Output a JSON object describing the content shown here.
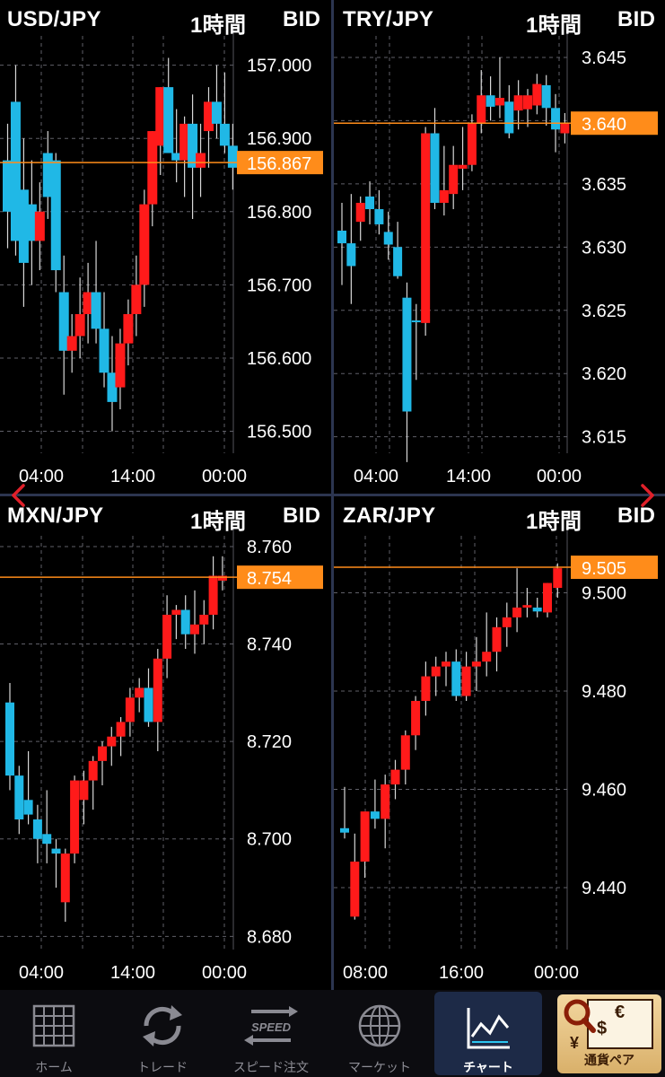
{
  "colors": {
    "up": "#ff1a1a",
    "down": "#20b8e6",
    "wick": "#d8d8d8",
    "price": "#ff8c1a",
    "grid": "#606068",
    "divider": "#2c3550"
  },
  "nav": {
    "prev_icon": "chevron-left-icon",
    "next_icon": "chevron-right-icon"
  },
  "charts": [
    {
      "pair": "USD/JPY",
      "timeframe": "1時間",
      "price_type": "BID",
      "current_price": "156.867",
      "current_value": 156.867,
      "y_ticks": [
        "157.000",
        "156.900",
        "156.800",
        "156.700",
        "156.600",
        "156.500"
      ],
      "ylim": [
        156.47,
        157.04
      ],
      "x_ticks": [
        "04:00",
        "14:00",
        "00:00"
      ],
      "candles": [
        [
          156.87,
          156.92,
          156.75,
          156.8
        ],
        [
          156.95,
          157.0,
          156.74,
          156.76
        ],
        [
          156.83,
          156.9,
          156.67,
          156.73
        ],
        [
          156.81,
          156.87,
          156.7,
          156.76
        ],
        [
          156.76,
          156.84,
          156.72,
          156.8
        ],
        [
          156.88,
          156.91,
          156.79,
          156.82
        ],
        [
          156.87,
          156.88,
          156.69,
          156.72
        ],
        [
          156.69,
          156.74,
          156.55,
          156.61
        ],
        [
          156.61,
          156.66,
          156.58,
          156.63
        ],
        [
          156.63,
          156.71,
          156.6,
          156.66
        ],
        [
          156.66,
          156.73,
          156.62,
          156.69
        ],
        [
          156.69,
          156.76,
          156.62,
          156.64
        ],
        [
          156.64,
          156.69,
          156.56,
          156.58
        ],
        [
          156.58,
          156.63,
          156.5,
          156.54
        ],
        [
          156.56,
          156.64,
          156.53,
          156.62
        ],
        [
          156.62,
          156.68,
          156.59,
          156.66
        ],
        [
          156.66,
          156.74,
          156.63,
          156.7
        ],
        [
          156.7,
          156.83,
          156.67,
          156.81
        ],
        [
          156.81,
          156.91,
          156.78,
          156.91
        ],
        [
          156.89,
          156.97,
          156.85,
          156.97
        ],
        [
          156.97,
          157.01,
          156.9,
          156.88
        ],
        [
          156.88,
          156.94,
          156.84,
          156.87
        ],
        [
          156.87,
          156.93,
          156.82,
          156.92
        ],
        [
          156.92,
          156.96,
          156.79,
          156.86
        ],
        [
          156.86,
          156.92,
          156.82,
          156.88
        ],
        [
          156.91,
          156.97,
          156.86,
          156.95
        ],
        [
          156.95,
          157.0,
          156.9,
          156.92
        ],
        [
          156.92,
          156.99,
          156.88,
          156.89
        ],
        [
          156.89,
          156.92,
          156.83,
          156.86
        ]
      ]
    },
    {
      "pair": "TRY/JPY",
      "timeframe": "1時間",
      "price_type": "BID",
      "current_price": "3.640",
      "current_value": 3.6398,
      "y_ticks": [
        "3.645",
        "3.640",
        "3.635",
        "3.630",
        "3.625",
        "3.620",
        "3.615"
      ],
      "ylim": [
        3.6137,
        3.6467
      ],
      "x_ticks": [
        "04:00",
        "14:00",
        "00:00"
      ],
      "candles": [
        [
          3.6313,
          3.6335,
          3.627,
          3.6303
        ],
        [
          3.6303,
          3.6342,
          3.6255,
          3.6285
        ],
        [
          3.632,
          3.634,
          3.6305,
          3.6335
        ],
        [
          3.634,
          3.6352,
          3.6318,
          3.633
        ],
        [
          3.633,
          3.6345,
          3.631,
          3.6318
        ],
        [
          3.6312,
          3.6328,
          3.629,
          3.6302
        ],
        [
          3.63,
          3.632,
          3.6275,
          3.6277
        ],
        [
          3.626,
          3.6272,
          3.613,
          3.617
        ],
        [
          3.6242,
          3.6255,
          3.6195,
          3.6241
        ],
        [
          3.624,
          3.6395,
          3.623,
          3.639
        ],
        [
          3.639,
          3.641,
          3.633,
          3.6335
        ],
        [
          3.6335,
          3.638,
          3.6325,
          3.6345
        ],
        [
          3.6342,
          3.638,
          3.633,
          3.6365
        ],
        [
          3.6362,
          3.6395,
          3.6345,
          3.6365
        ],
        [
          3.6365,
          3.6405,
          3.636,
          3.6398
        ],
        [
          3.6398,
          3.644,
          3.639,
          3.642
        ],
        [
          3.642,
          3.6435,
          3.64,
          3.6411
        ],
        [
          3.6412,
          3.645,
          3.6402,
          3.6418
        ],
        [
          3.6415,
          3.6428,
          3.6386,
          3.639
        ],
        [
          3.6408,
          3.6432,
          3.6393,
          3.642
        ],
        [
          3.6409,
          3.6425,
          3.6395,
          3.642
        ],
        [
          3.6412,
          3.6437,
          3.6405,
          3.6429
        ],
        [
          3.6428,
          3.6436,
          3.6396,
          3.641
        ],
        [
          3.641,
          3.6421,
          3.6375,
          3.6393
        ],
        [
          3.639,
          3.6406,
          3.6382,
          3.6398
        ]
      ]
    },
    {
      "pair": "MXN/JPY",
      "timeframe": "1時間",
      "price_type": "BID",
      "current_price": "8.754",
      "current_value": 8.7537,
      "y_ticks": [
        "8.760",
        "8.740",
        "8.720",
        "8.700",
        "8.680"
      ],
      "ylim": [
        8.6773,
        8.7622
      ],
      "x_ticks": [
        "04:00",
        "14:00",
        "00:00"
      ],
      "candles": [
        [
          8.728,
          8.732,
          8.71,
          8.713
        ],
        [
          8.713,
          8.715,
          8.701,
          8.704
        ],
        [
          8.708,
          8.718,
          8.703,
          8.705
        ],
        [
          8.704,
          8.707,
          8.695,
          8.7
        ],
        [
          8.701,
          8.71,
          8.695,
          8.699
        ],
        [
          8.698,
          8.7,
          8.69,
          8.697
        ],
        [
          8.687,
          8.698,
          8.683,
          8.697
        ],
        [
          8.697,
          8.713,
          8.695,
          8.712
        ],
        [
          8.708,
          8.714,
          8.703,
          8.712
        ],
        [
          8.712,
          8.717,
          8.706,
          8.716
        ],
        [
          8.716,
          8.72,
          8.711,
          8.719
        ],
        [
          8.719,
          8.723,
          8.715,
          8.721
        ],
        [
          8.721,
          8.725,
          8.717,
          8.724
        ],
        [
          8.724,
          8.731,
          8.721,
          8.729
        ],
        [
          8.729,
          8.733,
          8.726,
          8.731
        ],
        [
          8.731,
          8.735,
          8.723,
          8.724
        ],
        [
          8.724,
          8.739,
          8.718,
          8.737
        ],
        [
          8.737,
          8.75,
          8.733,
          8.746
        ],
        [
          8.746,
          8.748,
          8.741,
          8.747
        ],
        [
          8.747,
          8.75,
          8.739,
          8.742
        ],
        [
          8.742,
          8.751,
          8.738,
          8.744
        ],
        [
          8.744,
          8.749,
          8.74,
          8.746
        ],
        [
          8.746,
          8.758,
          8.743,
          8.754
        ],
        [
          8.753,
          8.758,
          8.751,
          8.754
        ]
      ]
    },
    {
      "pair": "ZAR/JPY",
      "timeframe": "1時間",
      "price_type": "BID",
      "current_price": "9.505",
      "current_value": 9.5052,
      "y_ticks": [
        "9.500",
        "9.480",
        "9.460",
        "9.440"
      ],
      "ylim": [
        9.4274,
        9.5116
      ],
      "x_ticks": [
        "08:00",
        "16:00",
        "00:00"
      ],
      "candles": [
        [
          9.4521,
          9.4605,
          9.45,
          9.4512
        ],
        [
          9.4341,
          9.451,
          9.4335,
          9.4453
        ],
        [
          9.4453,
          9.454,
          9.442,
          9.4555
        ],
        [
          9.4555,
          9.462,
          9.452,
          9.454
        ],
        [
          9.454,
          9.463,
          9.448,
          9.461
        ],
        [
          9.461,
          9.466,
          9.458,
          9.464
        ],
        [
          9.464,
          9.472,
          9.461,
          9.471
        ],
        [
          9.471,
          9.479,
          9.468,
          9.478
        ],
        [
          9.478,
          9.486,
          9.475,
          9.483
        ],
        [
          9.483,
          9.487,
          9.479,
          9.485
        ],
        [
          9.485,
          9.488,
          9.481,
          9.486
        ],
        [
          9.486,
          9.4885,
          9.478,
          9.479
        ],
        [
          9.479,
          9.488,
          9.478,
          9.485
        ],
        [
          9.485,
          9.491,
          9.48,
          9.486
        ],
        [
          9.486,
          9.496,
          9.483,
          9.488
        ],
        [
          9.488,
          9.495,
          9.484,
          9.493
        ],
        [
          9.493,
          9.498,
          9.489,
          9.495
        ],
        [
          9.495,
          9.505,
          9.492,
          9.497
        ],
        [
          9.497,
          9.501,
          9.495,
          9.4975
        ],
        [
          9.497,
          9.499,
          9.495,
          9.4962
        ],
        [
          9.496,
          9.502,
          9.495,
          9.502
        ],
        [
          9.501,
          9.506,
          9.499,
          9.505
        ]
      ]
    }
  ],
  "tabs": [
    {
      "label": "ホーム",
      "icon": "grid-icon"
    },
    {
      "label": "トレード",
      "icon": "refresh-arrows-icon"
    },
    {
      "label": "スピード注文",
      "icon": "speed-icon",
      "icon_text": "SPEED"
    },
    {
      "label": "マーケット",
      "icon": "globe-icon"
    },
    {
      "label": "チャート",
      "icon": "chart-icon"
    },
    {
      "label": "通貨ペア",
      "icon": "currency-search-icon",
      "icon_symbols": [
        "€",
        "$",
        "¥"
      ]
    }
  ]
}
